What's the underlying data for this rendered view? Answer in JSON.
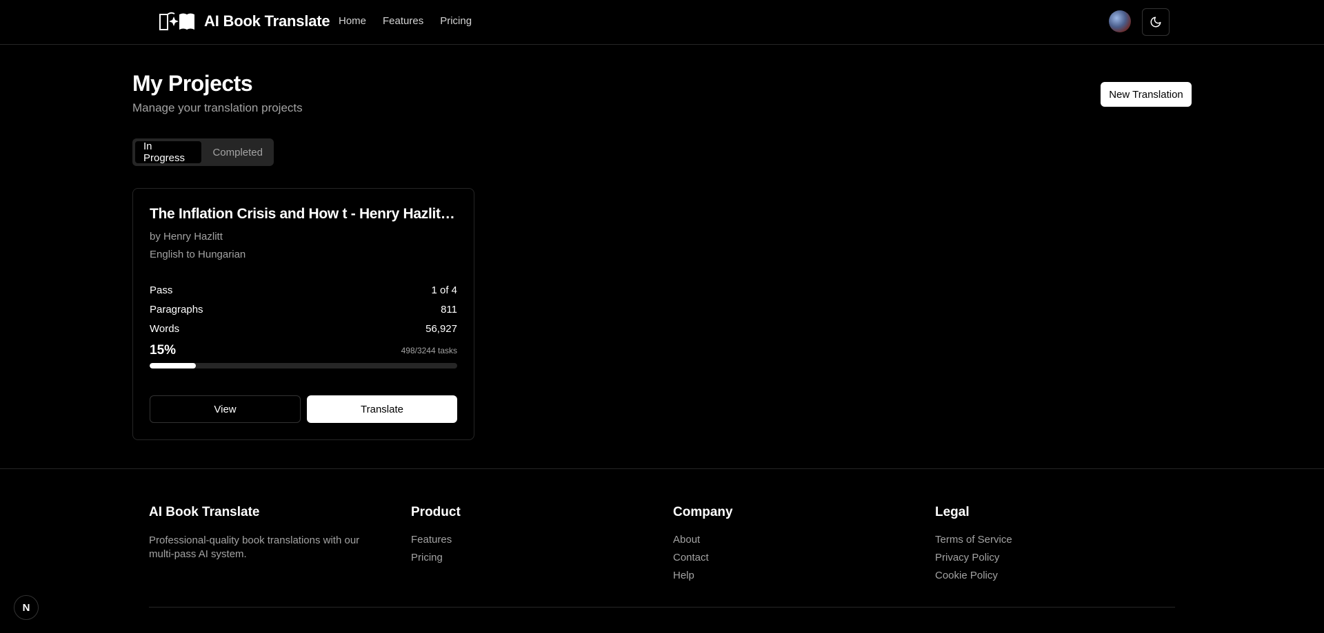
{
  "header": {
    "brand_name": "AI Book Translate",
    "logo_icon": "book-sparkle-icon",
    "nav": [
      "Home",
      "Features",
      "Pricing"
    ],
    "theme_icon": "moon-icon"
  },
  "main": {
    "title": "My Projects",
    "subtitle": "Manage your translation projects",
    "new_button": "New Translation",
    "tabs": [
      {
        "label": "In Progress",
        "active": true
      },
      {
        "label": "Completed",
        "active": false
      }
    ],
    "project": {
      "title": "The Inflation Crisis and How t - Henry Hazlitt e…",
      "author": "by Henry Hazlitt",
      "language": "English to Hungarian",
      "stats": [
        {
          "label": "Pass",
          "value": "1 of 4"
        },
        {
          "label": "Paragraphs",
          "value": "811"
        },
        {
          "label": "Words",
          "value": "56,927"
        }
      ],
      "percent_label": "15%",
      "progress": 0.15,
      "tasks": "498/3244 tasks",
      "view_button": "View",
      "translate_button": "Translate"
    }
  },
  "footer": {
    "brand": {
      "title": "AI Book Translate",
      "description": "Professional-quality book translations with our multi-pass AI system."
    },
    "product": {
      "title": "Product",
      "links": [
        "Features",
        "Pricing"
      ]
    },
    "company": {
      "title": "Company",
      "links": [
        "About",
        "Contact",
        "Help"
      ]
    },
    "legal": {
      "title": "Legal",
      "links": [
        "Terms of Service",
        "Privacy Policy",
        "Cookie Policy"
      ]
    }
  },
  "dev_badge": "N"
}
